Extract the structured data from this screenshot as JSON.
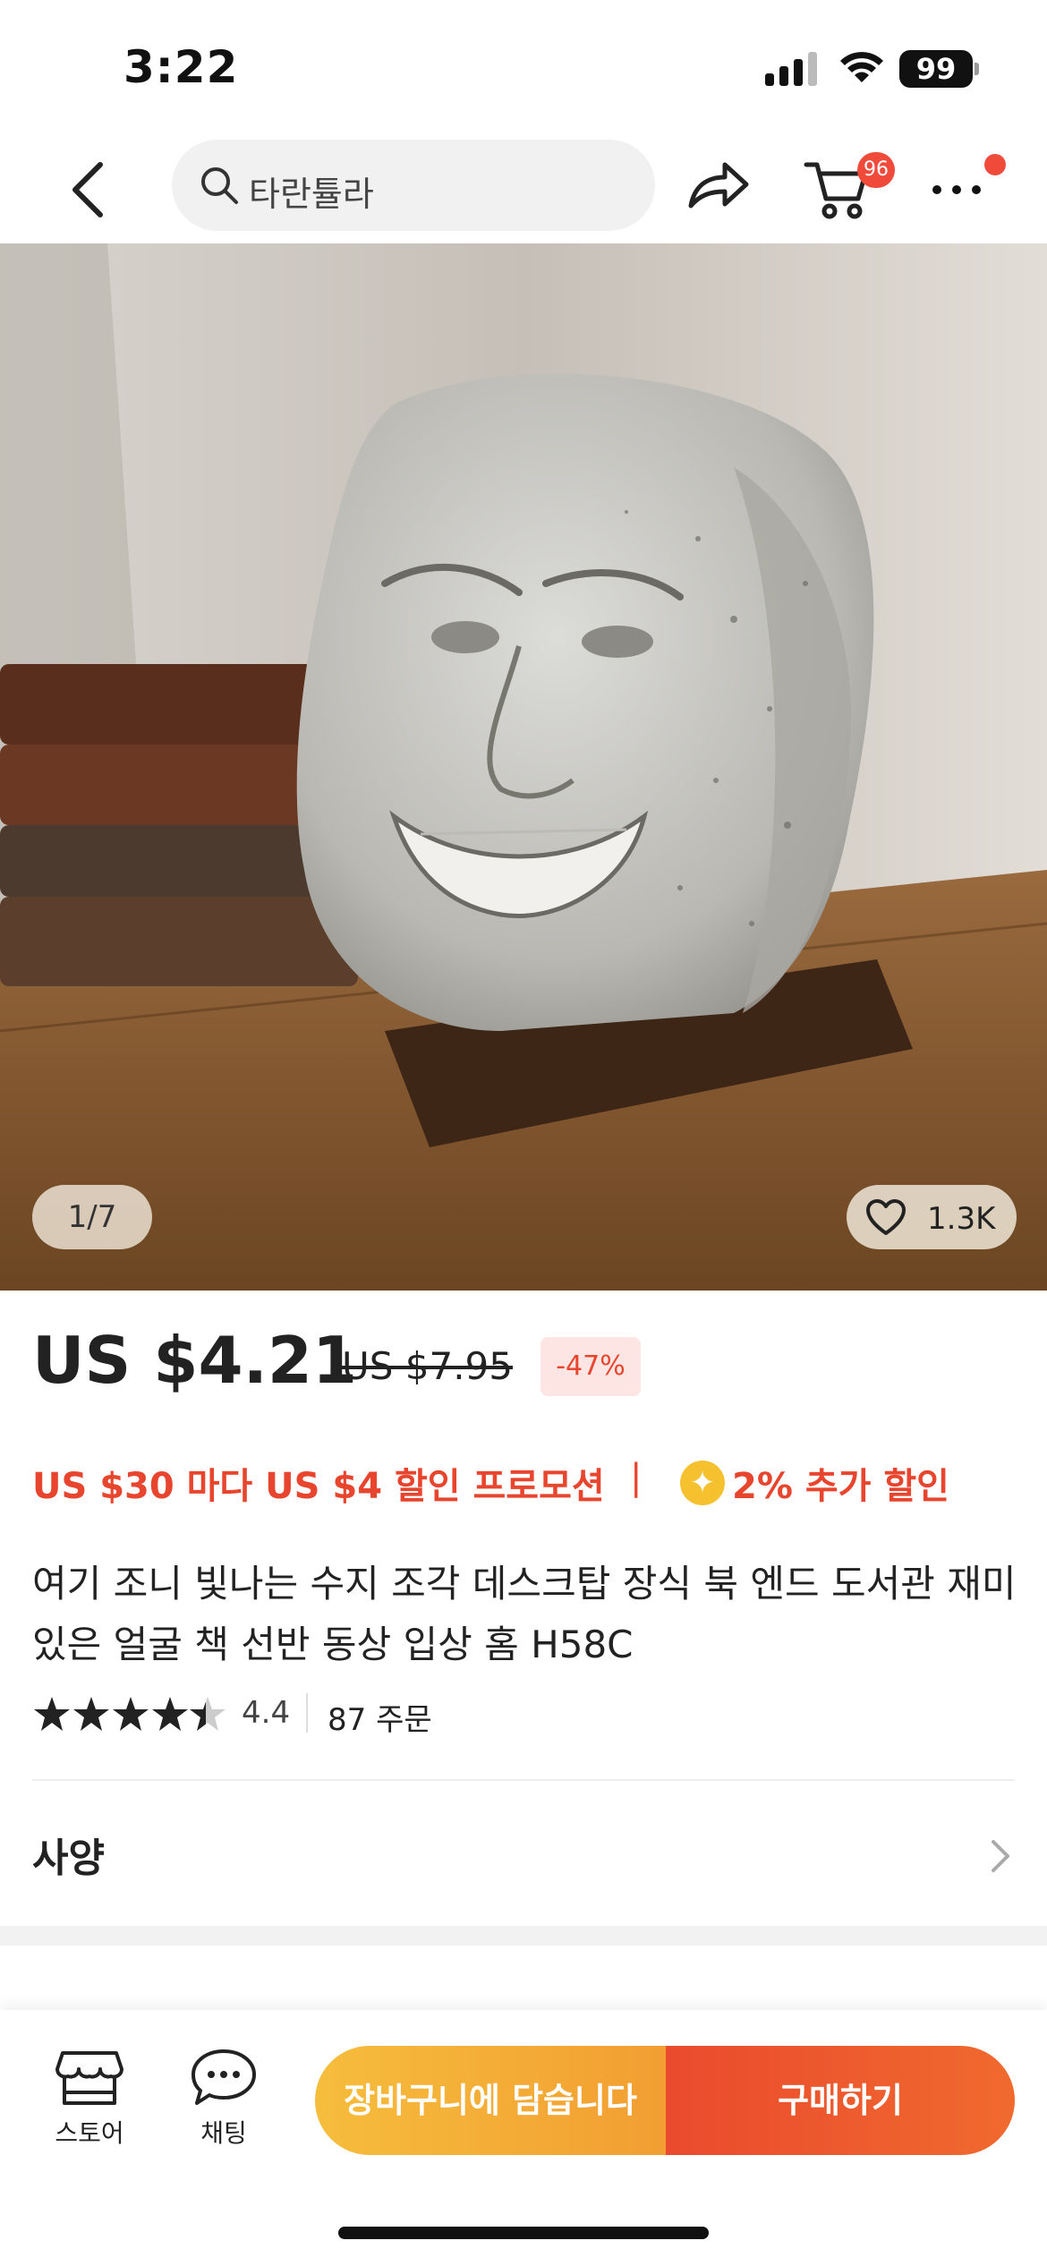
{
  "status_bar": {
    "time": "3:22",
    "battery": "99"
  },
  "nav": {
    "search_placeholder": "타란튤라",
    "cart_badge": "96",
    "icons": [
      "back-icon",
      "search-icon",
      "share-icon",
      "cart-icon",
      "more-icon"
    ]
  },
  "gallery": {
    "counter": "1/7",
    "likes": "1.3K"
  },
  "price": {
    "current": "US $4.21",
    "original": "US $7.95",
    "discount": "-47%"
  },
  "promo": {
    "deal": "US $30 마다 US $4 할인 프로모션",
    "divider": "|",
    "coin_symbol": "✦",
    "extra": "2% 추가 할인"
  },
  "product": {
    "title": "여기 조니 빛나는 수지 조각 데스크탑 장식 북 엔드 도서관 재미 있은 얼굴 책 선반 동상 입상 홈 H58C",
    "rating": "4.4",
    "rating_stars": 4.4,
    "orders": "87 주문"
  },
  "spec": {
    "label": "사양"
  },
  "bottom_bar": {
    "store_label": "스토어",
    "chat_label": "채팅",
    "add_to_cart": "장바구니에 담습니다",
    "buy_now": "구매하기"
  },
  "colors": {
    "accent_red": "#e8452e",
    "accent_orange": "#f29e32",
    "badge_red": "#f04a3b"
  }
}
